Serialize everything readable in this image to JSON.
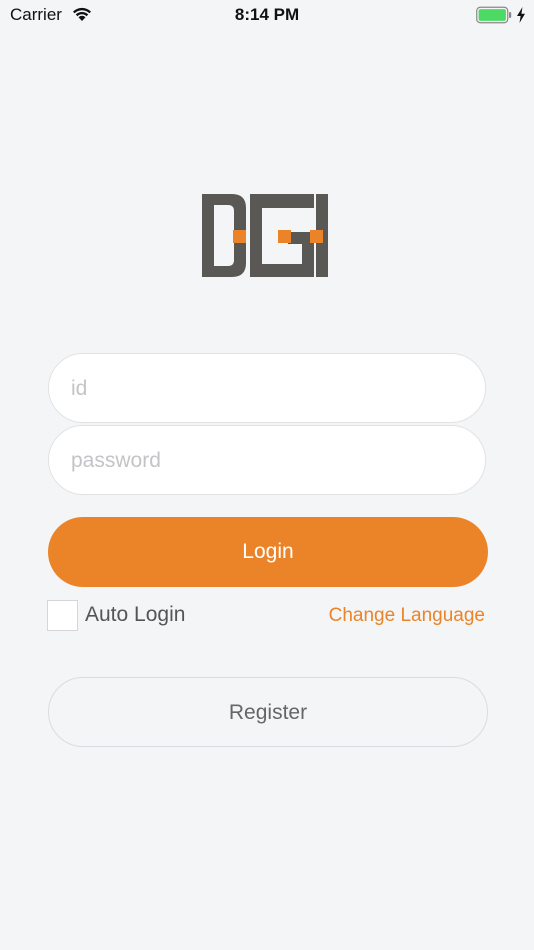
{
  "status_bar": {
    "carrier": "Carrier",
    "time": "8:14 PM",
    "battery_color": "#4cd964"
  },
  "logo": {
    "text": "DGI",
    "letter_color": "#5a5854",
    "accent_color": "#eb8428"
  },
  "login_form": {
    "id_placeholder": "id",
    "password_placeholder": "password",
    "login_label": "Login",
    "auto_login_label": "Auto Login",
    "auto_login_checked": false,
    "change_language_label": "Change Language",
    "register_label": "Register"
  },
  "colors": {
    "accent": "#eb8428",
    "background": "#f4f5f7"
  }
}
